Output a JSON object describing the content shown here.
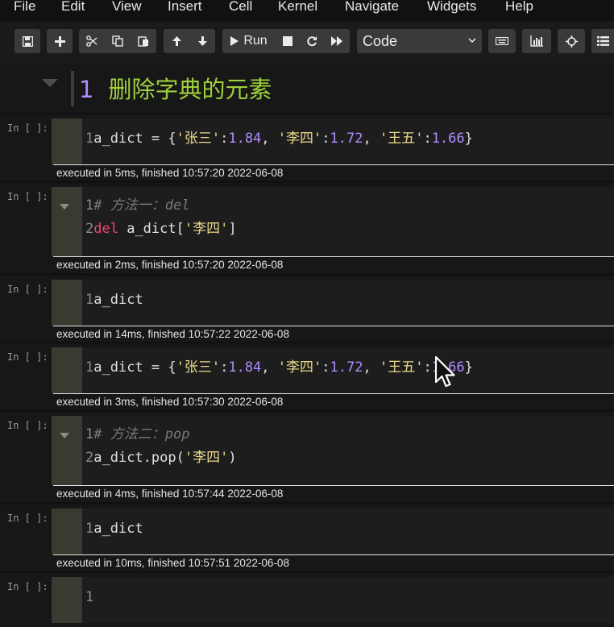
{
  "menu": [
    "File",
    "Edit",
    "View",
    "Insert",
    "Cell",
    "Kernel",
    "Navigate",
    "Widgets",
    "Help"
  ],
  "toolbar": {
    "run_label": "Run",
    "cell_type": "Code"
  },
  "heading": {
    "number": "1",
    "title": "删除字典的元素"
  },
  "cells": [
    {
      "prompt": "In [ ]:",
      "lines": [
        {
          "n": "1",
          "tokens": [
            [
              "txt",
              "a_dict = {"
            ],
            [
              "str",
              "'张三'"
            ],
            [
              "txt",
              ":"
            ],
            [
              "num",
              "1.84"
            ],
            [
              "txt",
              ", "
            ],
            [
              "str",
              "'李四'"
            ],
            [
              "txt",
              ":"
            ],
            [
              "num",
              "1.72"
            ],
            [
              "txt",
              ", "
            ],
            [
              "str",
              "'王五'"
            ],
            [
              "txt",
              ":"
            ],
            [
              "num",
              "1.66"
            ],
            [
              "txt",
              "}"
            ]
          ]
        }
      ],
      "exec": "executed in 5ms, finished 10:57:20 2022-06-08"
    },
    {
      "prompt": "In [ ]:",
      "lines": [
        {
          "n": "1",
          "tokens": [
            [
              "cmt",
              "# 方法一：del"
            ]
          ]
        },
        {
          "n": "2",
          "tokens": [
            [
              "kw",
              "del"
            ],
            [
              "txt",
              " a_dict["
            ],
            [
              "str",
              "'李四'"
            ],
            [
              "txt",
              "]"
            ]
          ]
        }
      ],
      "exec": "executed in 2ms, finished 10:57:20 2022-06-08"
    },
    {
      "prompt": "In [ ]:",
      "lines": [
        {
          "n": "1",
          "tokens": [
            [
              "txt",
              "a_dict"
            ]
          ]
        }
      ],
      "exec": "executed in 14ms, finished 10:57:22 2022-06-08"
    },
    {
      "prompt": "In [ ]:",
      "lines": [
        {
          "n": "1",
          "tokens": [
            [
              "txt",
              "a_dict = {"
            ],
            [
              "str",
              "'张三'"
            ],
            [
              "txt",
              ":"
            ],
            [
              "num",
              "1.84"
            ],
            [
              "txt",
              ", "
            ],
            [
              "str",
              "'李四'"
            ],
            [
              "txt",
              ":"
            ],
            [
              "num",
              "1.72"
            ],
            [
              "txt",
              ", "
            ],
            [
              "str",
              "'王五'"
            ],
            [
              "txt",
              ":"
            ],
            [
              "num",
              "1.66"
            ],
            [
              "txt",
              "}"
            ]
          ]
        }
      ],
      "exec": "executed in 3ms, finished 10:57:30 2022-06-08"
    },
    {
      "prompt": "In [ ]:",
      "lines": [
        {
          "n": "1",
          "tokens": [
            [
              "cmt",
              "# 方法二：pop"
            ]
          ]
        },
        {
          "n": "2",
          "tokens": [
            [
              "txt",
              "a_dict.pop("
            ],
            [
              "str",
              "'李四'"
            ],
            [
              "txt",
              ")"
            ]
          ]
        }
      ],
      "exec": "executed in 4ms, finished 10:57:44 2022-06-08"
    },
    {
      "prompt": "In [ ]:",
      "lines": [
        {
          "n": "1",
          "tokens": [
            [
              "txt",
              "a_dict"
            ]
          ]
        }
      ],
      "exec": "executed in 10ms, finished 10:57:51 2022-06-08"
    },
    {
      "prompt": "In [ ]:",
      "lines": [
        {
          "n": "1",
          "tokens": []
        }
      ],
      "exec": ""
    }
  ],
  "colors": {
    "heading": "#9ed03c",
    "string": "#ecd98a",
    "number": "#b18cff",
    "keyword": "#f0466e",
    "comment": "#7a7a7a",
    "background": "#111111"
  }
}
